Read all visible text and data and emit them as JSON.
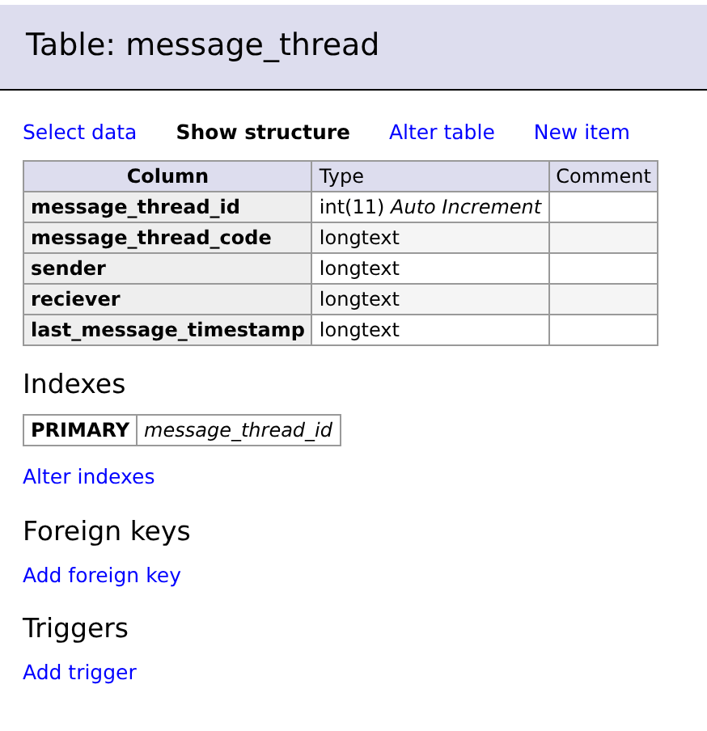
{
  "header": {
    "title": "Table: message_thread"
  },
  "links": [
    {
      "label": "Select data",
      "selected": false
    },
    {
      "label": "Show structure",
      "selected": true
    },
    {
      "label": "Alter table",
      "selected": false
    },
    {
      "label": "New item",
      "selected": false
    }
  ],
  "structure_table": {
    "columns": [
      "Column",
      "Type",
      "Comment"
    ],
    "rows": [
      {
        "column": "message_thread_id",
        "type": "int(11) *Auto Increment*"
      },
      {
        "column": "message_thread_code",
        "type": "longtext"
      },
      {
        "column": "sender",
        "type": "longtext"
      },
      {
        "column": "reciever",
        "type": "longtext"
      },
      {
        "column": "last_message_timestamp",
        "type": "longtext"
      }
    ]
  },
  "sections": [
    {
      "title": "Indexes",
      "indexes": [
        {
          "kind": "PRIMARY",
          "columns": "message_thread_id"
        }
      ],
      "link": "Alter indexes"
    },
    {
      "title": "Foreign keys",
      "link": "Add foreign key"
    },
    {
      "title": "Triggers",
      "link": "Add trigger"
    }
  ]
}
